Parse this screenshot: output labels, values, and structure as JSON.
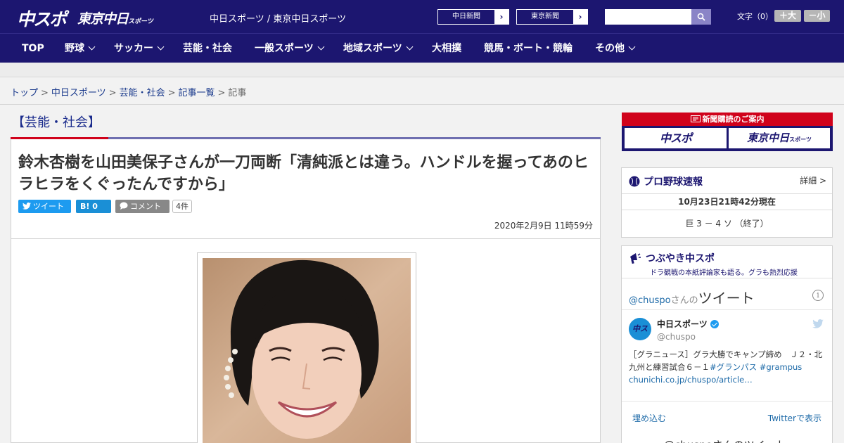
{
  "header": {
    "logo_chuspo": "中スポ",
    "logo_tokyo": "東京中日",
    "logo_tokyo_small": "スポーツ",
    "site_names": "中日スポーツ / 東京中日スポーツ",
    "ext_links": [
      "中日新聞",
      "東京新聞"
    ],
    "search_placeholder": "",
    "font_size_label": "文字（0）",
    "font_plus": "＋大",
    "font_minus": "－小"
  },
  "nav": {
    "items": [
      "TOP",
      "野球",
      "サッカー",
      "芸能・社会",
      "一般スポーツ",
      "地域スポーツ",
      "大相撲",
      "競馬・ボート・競輪",
      "その他"
    ],
    "has_dropdown": [
      false,
      true,
      true,
      false,
      true,
      true,
      false,
      false,
      true
    ]
  },
  "breadcrumb": {
    "items": [
      "トップ",
      "中日スポーツ",
      "芸能・社会",
      "記事一覧"
    ],
    "current": "記事",
    "separator": ">"
  },
  "article": {
    "category": "【芸能・社会】",
    "title": "鈴木杏樹を山田美保子さんが一刀両断「清純派とは違う。ハンドルを握ってあのヒラヒラをくぐったんですから」",
    "share_tweet": "ツイート",
    "share_hatena": "B! 0",
    "share_comment": "コメント",
    "comment_count": "4件",
    "date": "2020年2月9日 11時59分"
  },
  "sidebar": {
    "subscription": {
      "head": "新聞購読のご案内",
      "btn_chuspo": "中スポ",
      "btn_tokyo": "東京中日",
      "btn_tokyo_small": "スポーツ"
    },
    "baseball": {
      "title": "プロ野球速報",
      "detail": "詳細 >",
      "timestamp": "10月23日21時42分現在",
      "score": "巨 3 － 4 ソ （終了）"
    },
    "tweets": {
      "title": "つぶやき中スポ",
      "subtitle": "ドラ観戦の本紙評論家も語る。グラも熱烈応援",
      "for_handle": "@chuspo",
      "for_san": "さんの",
      "for_tweet": "ツイート",
      "user_name": "中日スポーツ",
      "user_handle": "@chuspo",
      "avatar_text": "中スポ",
      "tweet_text": "［グラニュース］グラ大勝でキャンプ締め　Ｊ２・北九州と練習試合６－１",
      "tweet_tags": "#グランパス #grampus",
      "tweet_link": "chunichi.co.jp/chuspo/article…",
      "embed": "埋め込む",
      "view_on_twitter": "Twitterで表示",
      "more_label": "@chuspoさんのツイート"
    }
  },
  "colors": {
    "brand_navy": "#1c1670",
    "accent_red": "#d0021b",
    "twitter_blue": "#1d9bf0",
    "link_blue": "#1a3a8c"
  }
}
